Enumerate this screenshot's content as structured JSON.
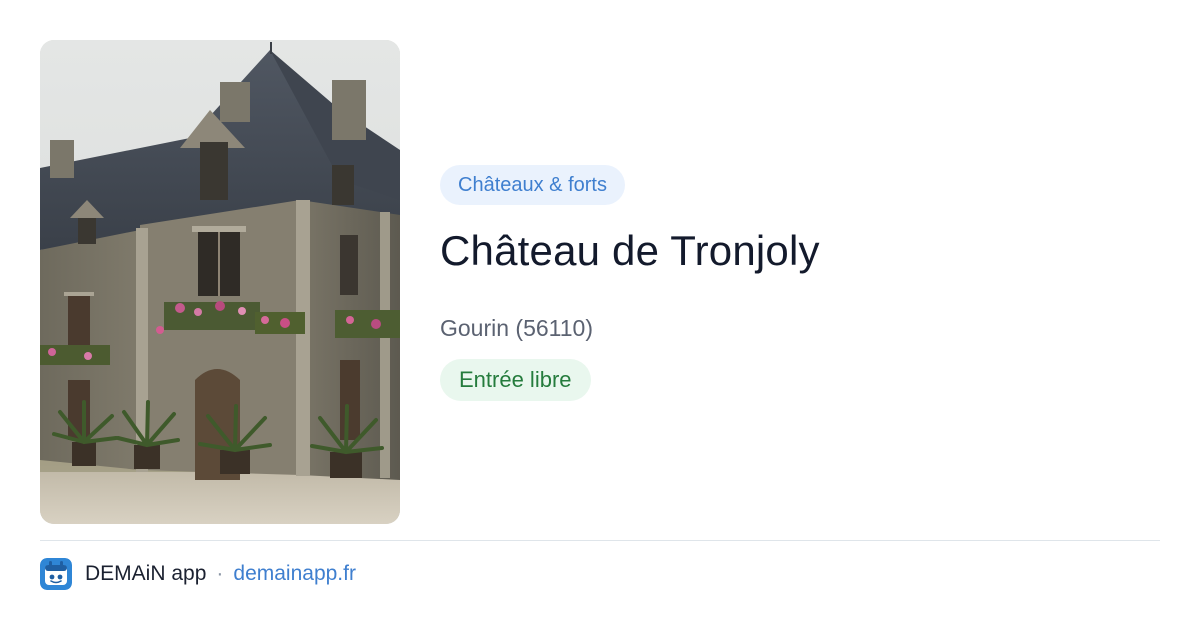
{
  "place": {
    "category": "Châteaux & forts",
    "title": "Château de Tronjoly",
    "location": "Gourin (56110)",
    "access": "Entrée libre"
  },
  "photo": {
    "subject": "chateau-building-photo"
  },
  "footer": {
    "app_name": "DEMAiN app",
    "separator": "·",
    "site": "demainapp.fr"
  },
  "colors": {
    "category_text": "#3f7fcf",
    "category_bg": "#eaf2fd",
    "access_text": "#257c3d",
    "access_bg": "#e9f7ee",
    "title": "#131a2c",
    "link": "#3f7fcf"
  }
}
